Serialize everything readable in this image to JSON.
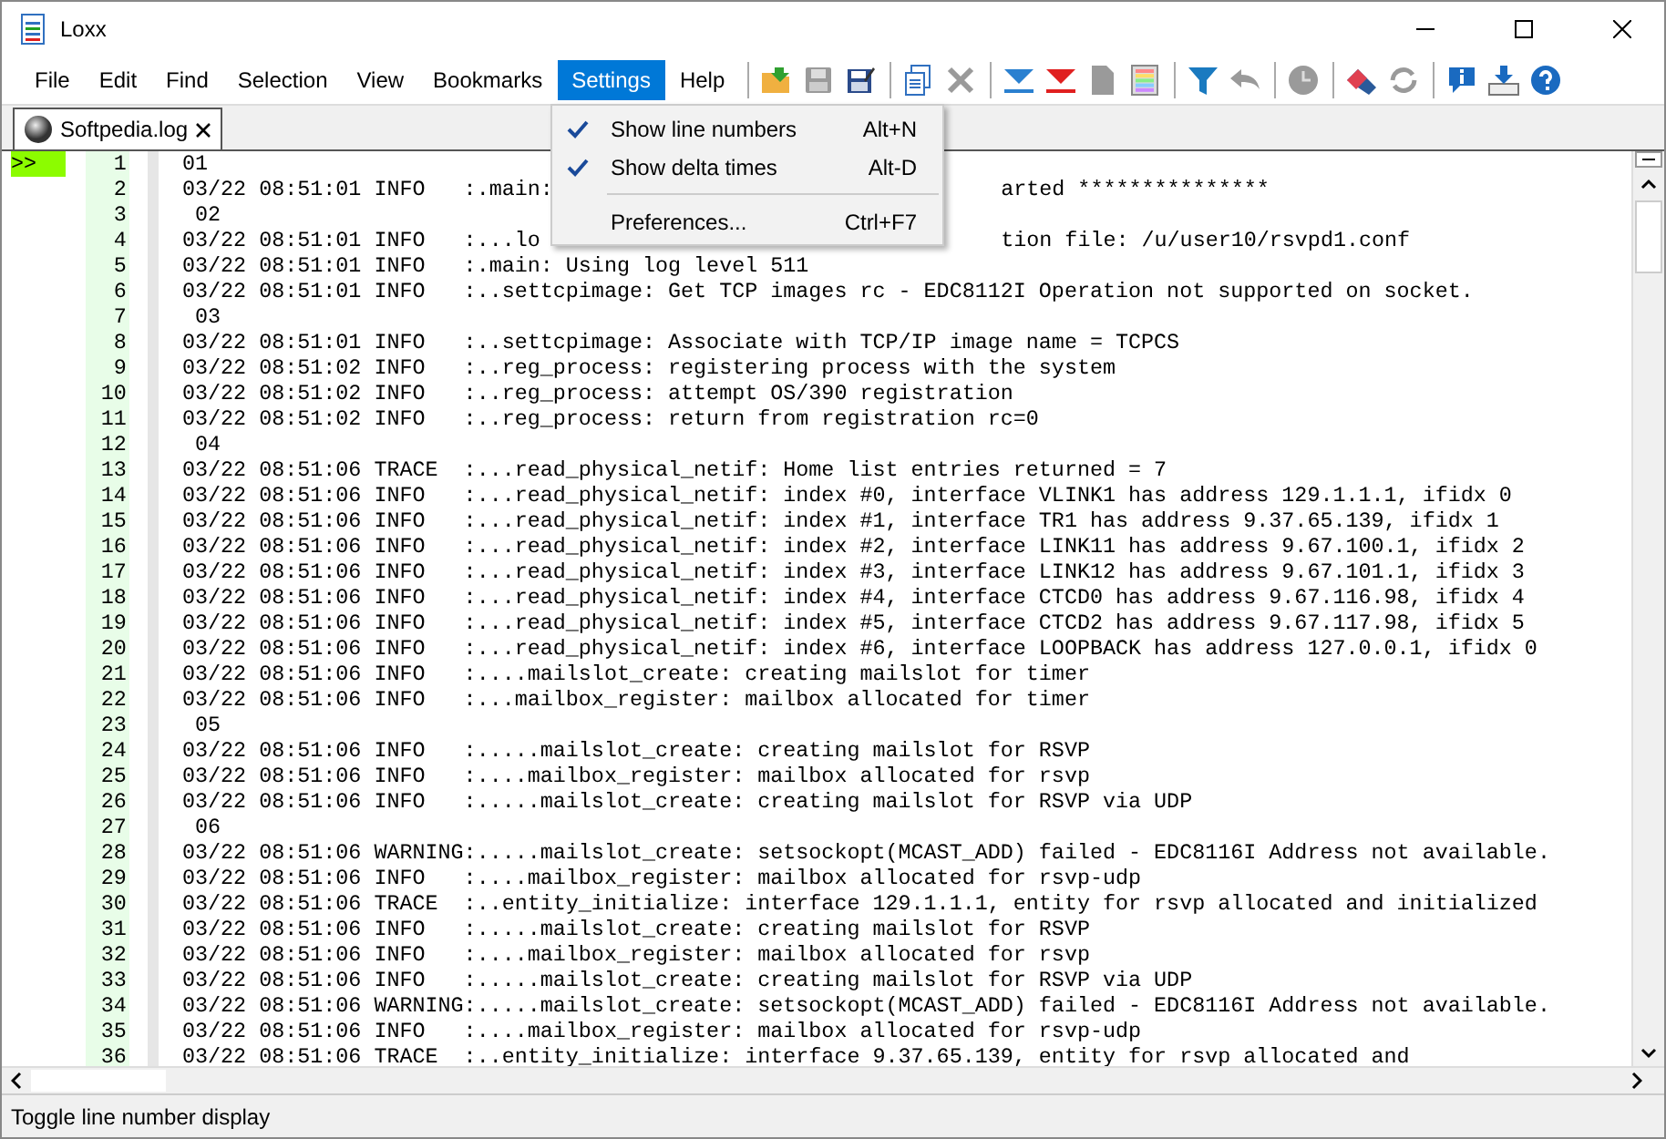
{
  "window": {
    "title": "Loxx"
  },
  "menu": [
    {
      "label": "File",
      "selected": false
    },
    {
      "label": "Edit",
      "selected": false
    },
    {
      "label": "Find",
      "selected": false
    },
    {
      "label": "Selection",
      "selected": false
    },
    {
      "label": "View",
      "selected": false
    },
    {
      "label": "Bookmarks",
      "selected": false
    },
    {
      "label": "Settings",
      "selected": true
    },
    {
      "label": "Help",
      "selected": false
    }
  ],
  "toolbar": [
    {
      "kind": "open",
      "disabled": false
    },
    {
      "kind": "save",
      "disabled": true
    },
    {
      "kind": "save-as",
      "disabled": false
    },
    {
      "kind": "separator"
    },
    {
      "kind": "copy",
      "disabled": false
    },
    {
      "kind": "delete",
      "disabled": true
    },
    {
      "kind": "separator"
    },
    {
      "kind": "down-blue",
      "disabled": false
    },
    {
      "kind": "down-red",
      "disabled": false
    },
    {
      "kind": "document",
      "disabled": true
    },
    {
      "kind": "color-list",
      "disabled": false
    },
    {
      "kind": "separator"
    },
    {
      "kind": "filter",
      "disabled": false
    },
    {
      "kind": "undo",
      "disabled": true
    },
    {
      "kind": "separator"
    },
    {
      "kind": "clock",
      "disabled": true
    },
    {
      "kind": "separator"
    },
    {
      "kind": "eraser",
      "disabled": false
    },
    {
      "kind": "refresh",
      "disabled": true
    },
    {
      "kind": "separator"
    },
    {
      "kind": "info",
      "disabled": false
    },
    {
      "kind": "download",
      "disabled": false
    },
    {
      "kind": "help",
      "disabled": false
    }
  ],
  "dropdown": {
    "items": [
      {
        "kind": "item",
        "label": "Show line numbers",
        "shortcut": "Alt+N",
        "checked": true
      },
      {
        "kind": "item",
        "label": "Show delta times",
        "shortcut": "Alt-D",
        "checked": true
      },
      {
        "kind": "separator"
      },
      {
        "kind": "item",
        "label": "Preferences...",
        "shortcut": "Ctrl+F7",
        "checked": false
      }
    ]
  },
  "tabs": [
    {
      "label": "Softpedia.log",
      "selected": true
    }
  ],
  "lines": [
    {
      "number": "1",
      "marker": ">>",
      "text": "01"
    },
    {
      "number": "2",
      "text": "03/22 08:51:01 INFO   :.main:",
      "tail": "arted ***************"
    },
    {
      "number": "3",
      "text": " 02"
    },
    {
      "number": "4",
      "text": "03/22 08:51:01 INFO   :...lo",
      "tail": "tion file: /u/user10/rsvpd1.conf"
    },
    {
      "number": "5",
      "text": "03/22 08:51:01 INFO   :.main: Using log level 511"
    },
    {
      "number": "6",
      "text": "03/22 08:51:01 INFO   :..settcpimage: Get TCP images rc - EDC8112I Operation not supported on socket."
    },
    {
      "number": "7",
      "text": " 03"
    },
    {
      "number": "8",
      "text": "03/22 08:51:01 INFO   :..settcpimage: Associate with TCP/IP image name = TCPCS"
    },
    {
      "number": "9",
      "text": "03/22 08:51:02 INFO   :..reg_process: registering process with the system"
    },
    {
      "number": "10",
      "text": "03/22 08:51:02 INFO   :..reg_process: attempt OS/390 registration"
    },
    {
      "number": "11",
      "text": "03/22 08:51:02 INFO   :..reg_process: return from registration rc=0"
    },
    {
      "number": "12",
      "text": " 04"
    },
    {
      "number": "13",
      "text": "03/22 08:51:06 TRACE  :...read_physical_netif: Home list entries returned = 7"
    },
    {
      "number": "14",
      "text": "03/22 08:51:06 INFO   :...read_physical_netif: index #0, interface VLINK1 has address 129.1.1.1, ifidx 0"
    },
    {
      "number": "15",
      "text": "03/22 08:51:06 INFO   :...read_physical_netif: index #1, interface TR1 has address 9.37.65.139, ifidx 1"
    },
    {
      "number": "16",
      "text": "03/22 08:51:06 INFO   :...read_physical_netif: index #2, interface LINK11 has address 9.67.100.1, ifidx 2"
    },
    {
      "number": "17",
      "text": "03/22 08:51:06 INFO   :...read_physical_netif: index #3, interface LINK12 has address 9.67.101.1, ifidx 3"
    },
    {
      "number": "18",
      "text": "03/22 08:51:06 INFO   :...read_physical_netif: index #4, interface CTCD0 has address 9.67.116.98, ifidx 4"
    },
    {
      "number": "19",
      "text": "03/22 08:51:06 INFO   :...read_physical_netif: index #5, interface CTCD2 has address 9.67.117.98, ifidx 5"
    },
    {
      "number": "20",
      "text": "03/22 08:51:06 INFO   :...read_physical_netif: index #6, interface LOOPBACK has address 127.0.0.1, ifidx 0"
    },
    {
      "number": "21",
      "text": "03/22 08:51:06 INFO   :....mailslot_create: creating mailslot for timer"
    },
    {
      "number": "22",
      "text": "03/22 08:51:06 INFO   :...mailbox_register: mailbox allocated for timer"
    },
    {
      "number": "23",
      "text": " 05"
    },
    {
      "number": "24",
      "text": "03/22 08:51:06 INFO   :.....mailslot_create: creating mailslot for RSVP"
    },
    {
      "number": "25",
      "text": "03/22 08:51:06 INFO   :....mailbox_register: mailbox allocated for rsvp"
    },
    {
      "number": "26",
      "text": "03/22 08:51:06 INFO   :.....mailslot_create: creating mailslot for RSVP via UDP"
    },
    {
      "number": "27",
      "text": " 06"
    },
    {
      "number": "28",
      "text": "03/22 08:51:06 WARNING:.....mailslot_create: setsockopt(MCAST_ADD) failed - EDC8116I Address not available."
    },
    {
      "number": "29",
      "text": "03/22 08:51:06 INFO   :....mailbox_register: mailbox allocated for rsvp-udp"
    },
    {
      "number": "30",
      "text": "03/22 08:51:06 TRACE  :..entity_initialize: interface 129.1.1.1, entity for rsvp allocated and initialized"
    },
    {
      "number": "31",
      "text": "03/22 08:51:06 INFO   :.....mailslot_create: creating mailslot for RSVP"
    },
    {
      "number": "32",
      "text": "03/22 08:51:06 INFO   :....mailbox_register: mailbox allocated for rsvp"
    },
    {
      "number": "33",
      "text": "03/22 08:51:06 INFO   :.....mailslot_create: creating mailslot for RSVP via UDP"
    },
    {
      "number": "34",
      "text": "03/22 08:51:06 WARNING:.....mailslot_create: setsockopt(MCAST_ADD) failed - EDC8116I Address not available."
    },
    {
      "number": "35",
      "text": "03/22 08:51:06 INFO   :....mailbox_register: mailbox allocated for rsvp-udp"
    },
    {
      "number": "36",
      "text": "03/22 08:51:06 TRACE  :..entity_initialize: interface 9.37.65.139, entity for rsvp allocated and"
    }
  ],
  "status_bar": {
    "text": "Toggle line number display"
  }
}
